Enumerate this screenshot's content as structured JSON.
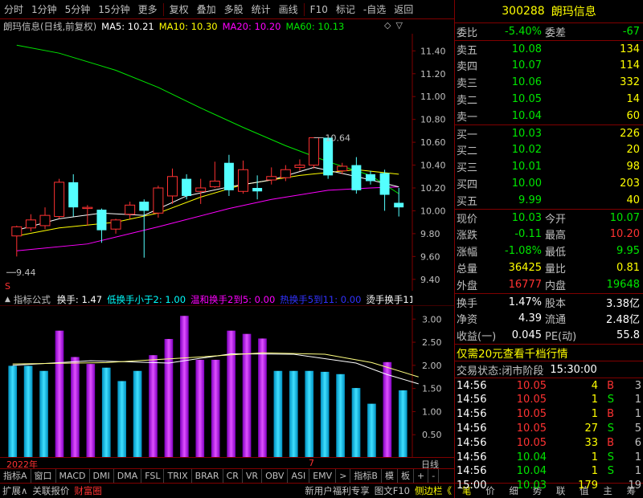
{
  "toolbar": {
    "items": [
      "分时",
      "1分钟",
      "5分钟",
      "15分钟",
      "更多",
      "复权",
      "叠加",
      "多股",
      "统计",
      "画线",
      "F10",
      "标记",
      "-自选",
      "返回"
    ]
  },
  "chart_header": {
    "title": "朗玛信息(日线,前复权)",
    "ma5": "MA5: 10.21",
    "ma10": "MA10: 10.30",
    "ma20": "MA20: 10.20",
    "ma60": "MA60: 10.13"
  },
  "indicator_header": {
    "title": "指标公式",
    "v1": "换手: 1.47",
    "v2": "低换手小于2: 1.00",
    "v3": "温和换手2到5: 0.00",
    "v4": "热换手5到11: 0.00",
    "v5": "烫手换手11"
  },
  "price_axis": [
    "11.40",
    "11.20",
    "11.00",
    "10.80",
    "10.60",
    "10.40",
    "10.20",
    "10.00",
    "9.80",
    "9.60",
    "9.40"
  ],
  "ind_axis": [
    "3.00",
    "2.50",
    "2.00",
    "1.50",
    "1.00",
    "0.50"
  ],
  "annot": {
    "high": "10.64",
    "low": "9.44"
  },
  "date_label": "2022年",
  "month_label": "7",
  "period_label": "日线",
  "tabs": [
    "指标A",
    "窗口",
    "MACD",
    "DMI",
    "DMA",
    "FSL",
    "TRIX",
    "BRAR",
    "CR",
    "VR",
    "OBV",
    "ASI",
    "EMV",
    ">",
    "指标B",
    "模",
    "板",
    "+",
    "-"
  ],
  "bottom": {
    "left": [
      "扩展∧",
      "关联报价",
      "财富圈"
    ],
    "right": [
      "新用户福利专享",
      "图文F10",
      "侧边栏《"
    ],
    "rp_tabs": [
      "笔",
      "价",
      "细",
      "势",
      "联",
      "值",
      "主",
      "筹"
    ]
  },
  "stock": {
    "code": "300288",
    "name": "朗玛信息"
  },
  "weibi": {
    "label1": "委比",
    "v1": "-5.40%",
    "label2": "委差",
    "v2": "-67"
  },
  "sell": [
    {
      "label": "卖五",
      "price": "10.08",
      "vol": "134"
    },
    {
      "label": "卖四",
      "price": "10.07",
      "vol": "114"
    },
    {
      "label": "卖三",
      "price": "10.06",
      "vol": "332"
    },
    {
      "label": "卖二",
      "price": "10.05",
      "vol": "14"
    },
    {
      "label": "卖一",
      "price": "10.04",
      "vol": "60"
    }
  ],
  "buy": [
    {
      "label": "买一",
      "price": "10.03",
      "vol": "226"
    },
    {
      "label": "买二",
      "price": "10.02",
      "vol": "20"
    },
    {
      "label": "买三",
      "price": "10.01",
      "vol": "98"
    },
    {
      "label": "买四",
      "price": "10.00",
      "vol": "203"
    },
    {
      "label": "买五",
      "price": "9.99",
      "vol": "40"
    }
  ],
  "quote": [
    {
      "l1": "现价",
      "v1": "10.03",
      "c1": "green",
      "l2": "今开",
      "v2": "10.07",
      "c2": "green"
    },
    {
      "l1": "涨跌",
      "v1": "-0.11",
      "c1": "green",
      "l2": "最高",
      "v2": "10.20",
      "c2": "red"
    },
    {
      "l1": "涨幅",
      "v1": "-1.08%",
      "c1": "green",
      "l2": "最低",
      "v2": "9.95",
      "c2": "green"
    },
    {
      "l1": "总量",
      "v1": "36425",
      "c1": "yel",
      "l2": "量比",
      "v2": "0.81",
      "c2": "yel"
    },
    {
      "l1": "外盘",
      "v1": "16777",
      "c1": "red",
      "l2": "内盘",
      "v2": "19648",
      "c2": "green"
    }
  ],
  "stats": [
    {
      "l1": "换手",
      "v1": "1.47%",
      "l2": "股本",
      "v2": "3.38亿"
    },
    {
      "l1": "净资",
      "v1": "4.39",
      "l2": "流通",
      "v2": "2.48亿"
    },
    {
      "l1": "收益(一)",
      "v1": "0.045",
      "l2": "PE(动)",
      "v2": "55.8"
    }
  ],
  "promo": "仅需20元查看千档行情",
  "trade_status": {
    "label": "交易状态:",
    "value": "闭市阶段",
    "time": "15:30:00"
  },
  "ticks": [
    {
      "t": "14:56",
      "p": "10.05",
      "pc": "red",
      "v": "4",
      "bs": "B",
      "bsc": "red",
      "n": "3"
    },
    {
      "t": "14:56",
      "p": "10.05",
      "pc": "red",
      "v": "1",
      "bs": "S",
      "bsc": "green",
      "n": "1"
    },
    {
      "t": "14:56",
      "p": "10.05",
      "pc": "red",
      "v": "1",
      "bs": "B",
      "bsc": "red",
      "n": "1"
    },
    {
      "t": "14:56",
      "p": "10.05",
      "pc": "red",
      "v": "27",
      "bs": "S",
      "bsc": "green",
      "n": "5"
    },
    {
      "t": "14:56",
      "p": "10.05",
      "pc": "red",
      "v": "33",
      "bs": "B",
      "bsc": "red",
      "n": "6"
    },
    {
      "t": "14:56",
      "p": "10.04",
      "pc": "green",
      "v": "1",
      "bs": "S",
      "bsc": "green",
      "n": "1"
    },
    {
      "t": "14:56",
      "p": "10.04",
      "pc": "green",
      "v": "1",
      "bs": "S",
      "bsc": "green",
      "n": "1"
    },
    {
      "t": "15:00",
      "p": "10.03",
      "pc": "green",
      "v": "179",
      "bs": "",
      "bsc": "",
      "n": "19"
    }
  ],
  "chart_data": {
    "type": "candlestick",
    "candles": [
      [
        9.78,
        9.86,
        9.6,
        9.87
      ],
      [
        9.85,
        9.92,
        9.82,
        9.97
      ],
      [
        9.87,
        9.96,
        9.84,
        10.03
      ],
      [
        9.95,
        10.25,
        9.93,
        10.28
      ],
      [
        10.25,
        10.03,
        9.95,
        10.32
      ],
      [
        10.02,
        10.03,
        9.87,
        10.05
      ],
      [
        10.01,
        9.83,
        9.72,
        10.02
      ],
      [
        9.84,
        9.92,
        9.8,
        9.93
      ],
      [
        9.97,
        10.05,
        9.93,
        10.08
      ],
      [
        10.08,
        10.0,
        9.59,
        10.1
      ],
      [
        9.98,
        10.2,
        9.94,
        10.22
      ],
      [
        10.13,
        10.3,
        10.06,
        10.37
      ],
      [
        10.28,
        10.13,
        10.1,
        10.32
      ],
      [
        10.17,
        10.2,
        10.06,
        10.28
      ],
      [
        10.21,
        10.26,
        10.2,
        10.43
      ],
      [
        10.42,
        10.18,
        10.13,
        10.49
      ],
      [
        10.17,
        10.36,
        10.15,
        10.44
      ],
      [
        10.2,
        10.17,
        10.1,
        10.31
      ],
      [
        10.27,
        10.3,
        10.23,
        10.38
      ],
      [
        10.29,
        10.36,
        10.26,
        10.4
      ],
      [
        10.38,
        10.4,
        10.35,
        10.45
      ],
      [
        10.4,
        10.64,
        10.37,
        10.64
      ],
      [
        10.64,
        10.31,
        10.28,
        10.58
      ],
      [
        10.35,
        10.39,
        10.32,
        10.42
      ],
      [
        10.4,
        10.18,
        10.15,
        10.47
      ],
      [
        10.32,
        10.26,
        10.23,
        10.35
      ],
      [
        10.33,
        10.14,
        10.0,
        10.36
      ],
      [
        10.07,
        10.03,
        9.95,
        10.2
      ]
    ],
    "up_color": "#ff3232",
    "down_color": "#54ffff",
    "ma60": [
      [
        0,
        11.45
      ],
      [
        3,
        11.38
      ],
      [
        7,
        11.23
      ],
      [
        10,
        11.08
      ],
      [
        13,
        10.9
      ],
      [
        16,
        10.73
      ],
      [
        19,
        10.57
      ],
      [
        22,
        10.43
      ],
      [
        25,
        10.31
      ],
      [
        27,
        10.15
      ]
    ],
    "ma20": [
      [
        0,
        9.65
      ],
      [
        5,
        9.71
      ],
      [
        10,
        9.86
      ],
      [
        15,
        10.02
      ],
      [
        18,
        10.1
      ],
      [
        22,
        10.18
      ],
      [
        25,
        10.2
      ],
      [
        27,
        10.21
      ]
    ],
    "ma10": [
      [
        0,
        9.78
      ],
      [
        3,
        9.85
      ],
      [
        7,
        9.9
      ],
      [
        10,
        9.98
      ],
      [
        13,
        10.12
      ],
      [
        16,
        10.23
      ],
      [
        20,
        10.31
      ],
      [
        24,
        10.36
      ],
      [
        27,
        10.32
      ]
    ],
    "ma5": [
      [
        0,
        9.83
      ],
      [
        3,
        9.93
      ],
      [
        6,
        9.98
      ],
      [
        9,
        9.96
      ],
      [
        12,
        10.13
      ],
      [
        15,
        10.21
      ],
      [
        18,
        10.27
      ],
      [
        21,
        10.38
      ],
      [
        24,
        10.3
      ],
      [
        27,
        10.21
      ]
    ],
    "turnover": [
      1.99,
      1.99,
      1.88,
      2.75,
      2.18,
      2.03,
      1.95,
      1.66,
      1.88,
      2.22,
      2.57,
      3.07,
      2.12,
      2.12,
      2.75,
      2.68,
      2.58,
      1.88,
      1.88,
      1.88,
      1.86,
      1.81,
      1.51,
      1.17,
      2.07,
      1.46
    ],
    "turnover_highlight": [
      3,
      4,
      5,
      9,
      10,
      11,
      12,
      13,
      14,
      15,
      16,
      24
    ],
    "ma_turnover_a": [
      [
        0,
        2.0
      ],
      [
        5,
        2.1
      ],
      [
        10,
        2.05
      ],
      [
        14,
        2.25
      ],
      [
        18,
        2.24
      ],
      [
        22,
        2.05
      ],
      [
        24,
        1.8
      ],
      [
        26,
        1.6
      ]
    ],
    "ma_turnover_b": [
      [
        0,
        2.03
      ],
      [
        6,
        2.06
      ],
      [
        11,
        2.16
      ],
      [
        16,
        2.27
      ],
      [
        20,
        2.24
      ],
      [
        23,
        2.06
      ],
      [
        26,
        1.75
      ]
    ],
    "price_range": [
      9.3,
      11.55
    ],
    "ind_range": [
      0,
      3.3
    ]
  }
}
